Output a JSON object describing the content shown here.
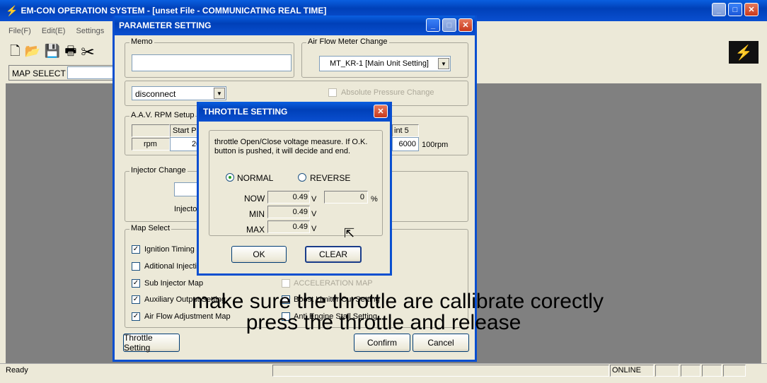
{
  "main": {
    "title": "EM-CON OPERATION SYSTEM - [unset File - COMMUNICATING REAL TIME]",
    "menu": [
      "File(F)",
      "Edit(E)",
      "Settings"
    ],
    "map_select_label": "MAP SELECT",
    "status_ready": "Ready",
    "status_online": "ONLINE"
  },
  "param": {
    "title": "PARAMETER SETTING",
    "memo_label": "Memo",
    "memo_value": "",
    "afm_label": "Air Flow Meter Change",
    "afm_value": "MT_KR-1 [Main Unit Setting]",
    "connect_value": "disconnect",
    "abs_pressure": "Absolute Pressure Change",
    "aav_label": "A.A.V. RPM Setup",
    "start_point": "Start Po",
    "point5": "int 5",
    "rpm_label": "rpm",
    "rpm_first": "20",
    "rpm_last": "6000",
    "rpm_unit": "100rpm",
    "injector_label": "Injector Change",
    "injector_sub": "Injecto",
    "map_select_label": "Map Select",
    "maps": [
      {
        "label": "Ignition Timing",
        "checked": true
      },
      {
        "label": "Aditional Injectio",
        "checked": false
      },
      {
        "label": "Sub Injector Map",
        "checked": true
      },
      {
        "label": "Auxiliary Output Setting",
        "checked": true
      },
      {
        "label": "Air Flow Adjustment Map",
        "checked": true
      }
    ],
    "maps_right": [
      {
        "label": "ACCELERATION MAP",
        "checked": false
      },
      {
        "label": "Boost Limiter Cut Setting",
        "checked": false
      },
      {
        "label": "Anti Engine Stall Setting",
        "checked": false
      }
    ],
    "throttle_btn": "Throttle Setting",
    "confirm": "Confirm",
    "cancel": "Cancel"
  },
  "throttle": {
    "title": "THROTTLE SETTING",
    "desc": "throttle Open/Close voltage measure. If O.K. button is pushed, it will decide and end.",
    "normal": "NORMAL",
    "reverse": "REVERSE",
    "now_label": "NOW",
    "min_label": "MIN",
    "max_label": "MAX",
    "now_value": "0.49",
    "min_value": "0.49",
    "max_value": "0.49",
    "volt": "V",
    "pct_value": "0",
    "pct_unit": "%",
    "ok": "OK",
    "clear": "CLEAR"
  },
  "caption": {
    "line1": "make sure the throttle are callibrate corectly",
    "line2": "press the throttle and release"
  }
}
